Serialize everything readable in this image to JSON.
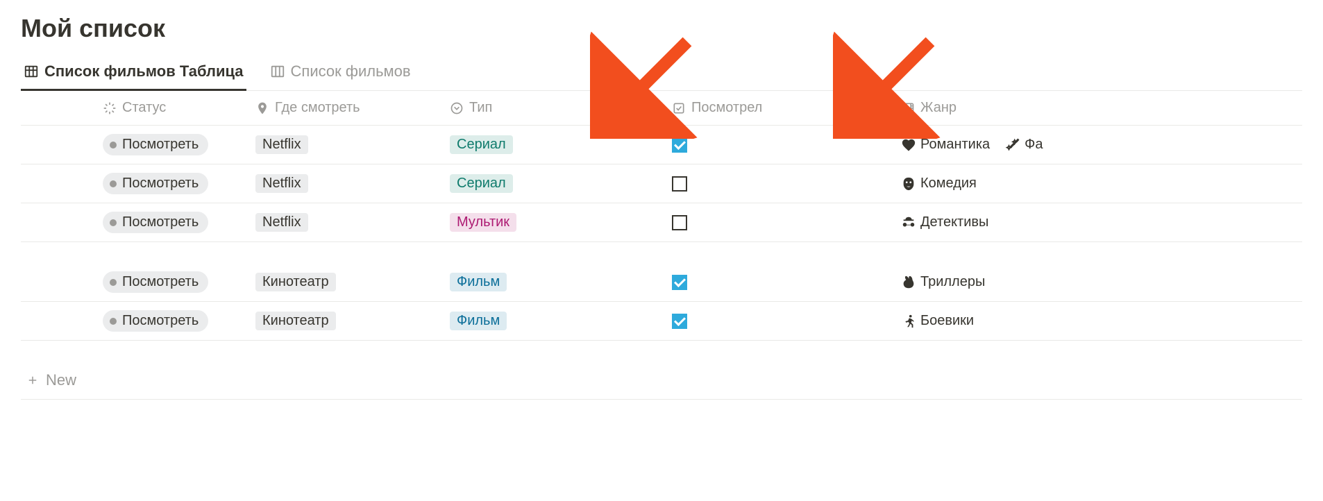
{
  "page": {
    "title": "Мой список"
  },
  "tabs": [
    {
      "label": "Список фильмов Таблица",
      "active": true
    },
    {
      "label": "Список фильмов",
      "active": false
    }
  ],
  "columns": [
    {
      "key": "spacer",
      "label": ""
    },
    {
      "key": "status",
      "label": "Статус",
      "icon": "sparkle"
    },
    {
      "key": "where",
      "label": "Где смотреть",
      "icon": "pin"
    },
    {
      "key": "type",
      "label": "Тип",
      "icon": "select"
    },
    {
      "key": "watched",
      "label": "Посмотрел",
      "icon": "checkbox"
    },
    {
      "key": "genre",
      "label": "Жанр",
      "icon": "film"
    }
  ],
  "rows_group1": [
    {
      "status": "Посмотреть",
      "where": "Netflix",
      "type": {
        "label": "Сериал",
        "color": "green"
      },
      "watched": true,
      "genres": [
        {
          "icon": "heart",
          "label": "Романтика"
        },
        {
          "icon": "magic",
          "label": "Фа"
        }
      ]
    },
    {
      "status": "Посмотреть",
      "where": "Netflix",
      "type": {
        "label": "Сериал",
        "color": "green"
      },
      "watched": false,
      "genres": [
        {
          "icon": "mask",
          "label": "Комедия"
        }
      ]
    },
    {
      "status": "Посмотреть",
      "where": "Netflix",
      "type": {
        "label": "Мультик",
        "color": "pink"
      },
      "watched": false,
      "genres": [
        {
          "icon": "spy",
          "label": "Детективы"
        }
      ]
    }
  ],
  "rows_group2": [
    {
      "status": "Посмотреть",
      "where": "Кинотеатр",
      "type": {
        "label": "Фильм",
        "color": "blue"
      },
      "watched": true,
      "genres": [
        {
          "icon": "rabbit",
          "label": "Триллеры"
        }
      ]
    },
    {
      "status": "Посмотреть",
      "where": "Кинотеатр",
      "type": {
        "label": "Фильм",
        "color": "blue"
      },
      "watched": true,
      "genres": [
        {
          "icon": "run",
          "label": "Боевики"
        }
      ]
    }
  ],
  "new_row": {
    "label": "New"
  },
  "annotations": {
    "arrow1_target": "type",
    "arrow2_target": "watched"
  }
}
